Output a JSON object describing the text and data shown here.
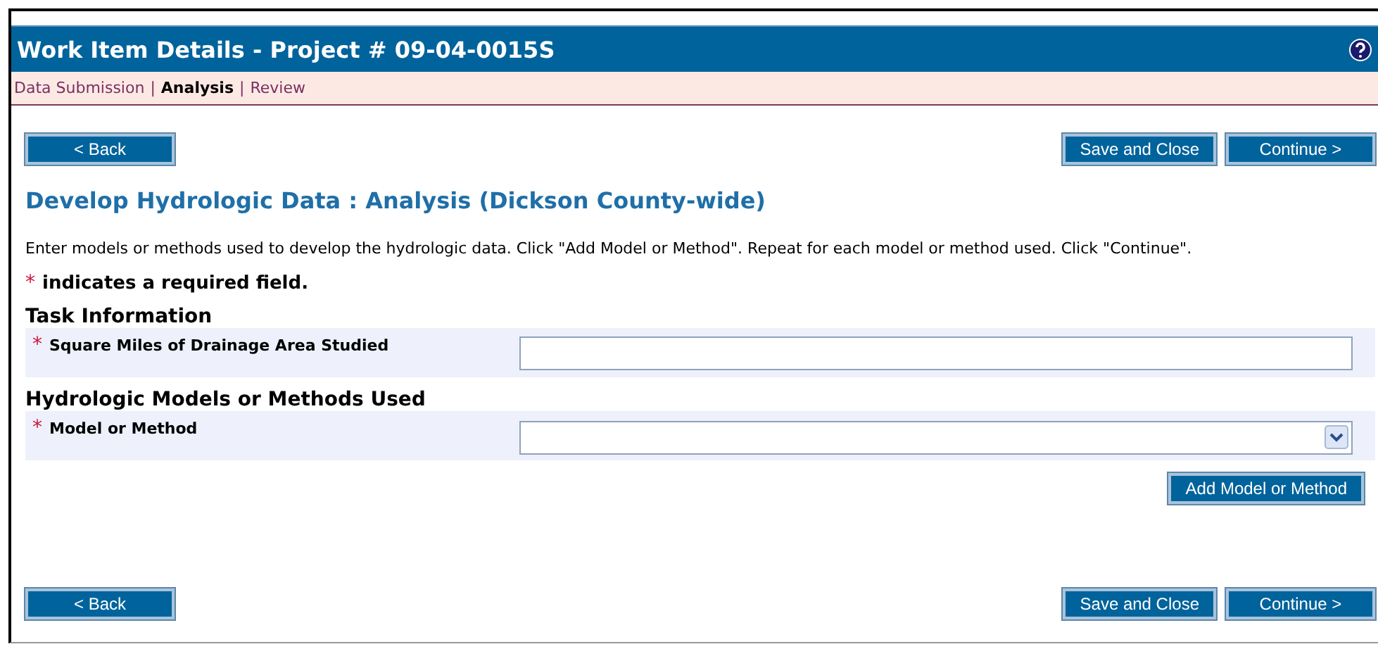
{
  "header": {
    "title": "Work Item Details - Project # 09-04-0015S"
  },
  "breadcrumb_separator": "|",
  "breadcrumb": [
    {
      "label": "Data Submission",
      "selected": false
    },
    {
      "label": "Analysis",
      "selected": true
    },
    {
      "label": "Review",
      "selected": false
    }
  ],
  "top_buttons": {
    "left": [
      "< Back"
    ],
    "right": [
      "Save and Close",
      "Continue >"
    ]
  },
  "heading": "Develop Hydrologic Data : Analysis (Dickson County-wide)",
  "instructions": "Enter models or methods used to develop the hydrologic data. Click \"Add Model or Method\". Repeat for each model or method used. Click \"Continue\".",
  "required_note": {
    "mark": "*",
    "text": "indicates a required field."
  },
  "sections": [
    {
      "title": "Task Information",
      "fields": [
        {
          "kind": "text",
          "mark": "*",
          "label": "Square Miles of Drainage Area Studied"
        }
      ]
    },
    {
      "title": "Hydrologic Models or Methods Used",
      "fields": [
        {
          "kind": "select",
          "mark": "*",
          "label": "Model or Method"
        }
      ],
      "action": "Add Model or Method"
    }
  ],
  "bottom_buttons": {
    "left": [
      "< Back"
    ],
    "right": [
      "Save and Close",
      "Continue >"
    ]
  }
}
